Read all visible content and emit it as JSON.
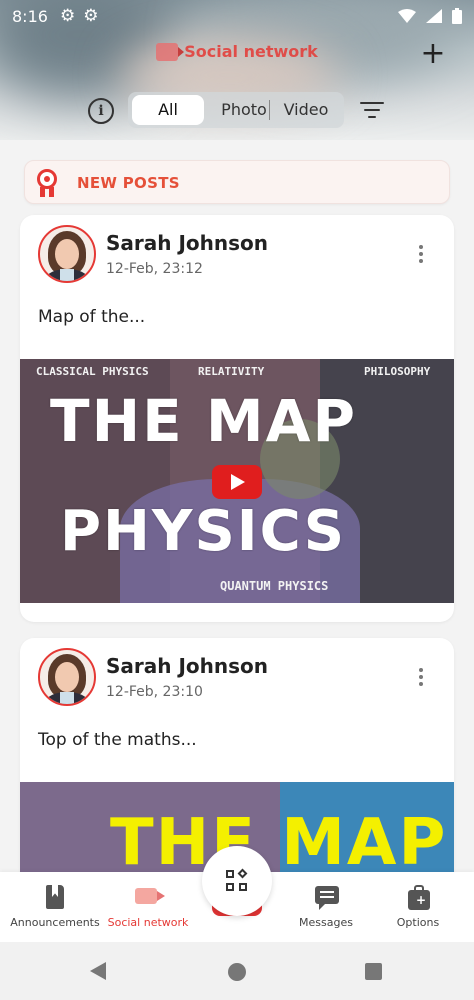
{
  "status_bar": {
    "time": "8:16",
    "icons": [
      "gear-icon",
      "gear-icon",
      "wifi-icon",
      "signal-icon",
      "battery-icon"
    ]
  },
  "header": {
    "app_title": "Social network",
    "add_icon": "plus-icon"
  },
  "filters": {
    "tabs": [
      {
        "label": "All",
        "selected": true
      },
      {
        "label": "Photo"
      },
      {
        "label": "Video"
      }
    ]
  },
  "banner": {
    "label": "NEW POSTS"
  },
  "posts": [
    {
      "author": "Sarah Johnson",
      "date": "12-Feb, 23:12",
      "text": "Map of the...",
      "media": {
        "labels": [
          "CLASSICAL PHYSICS",
          "RELATIVITY",
          "PHILOSOPHY"
        ],
        "big1": "THE MAP",
        "big2": "PHYSICS",
        "footer": "QUANTUM PHYSICS"
      }
    },
    {
      "author": "Sarah Johnson",
      "date": "12-Feb, 23:10",
      "text": "Top of the maths...",
      "media": {
        "big1": "THE MAP"
      }
    }
  ],
  "bottom_nav": [
    {
      "label": "Announcements"
    },
    {
      "label": "Social network",
      "active": true
    },
    {
      "label": "Messages"
    },
    {
      "label": "Options"
    }
  ],
  "colors": {
    "accent": "#e53935",
    "banner_bg": "#fbf3f1",
    "banner_text": "#e55039"
  }
}
